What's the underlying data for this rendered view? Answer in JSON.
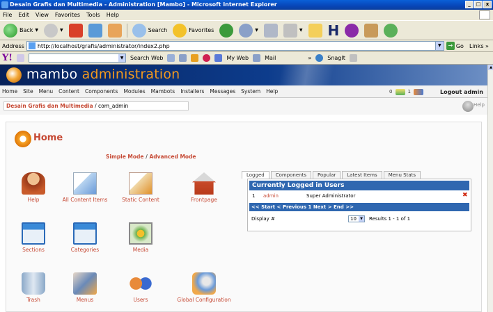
{
  "window": {
    "title": "Desain Grafis dan Multimedia - Administration [Mambo] - Microsoft Internet Explorer",
    "buttons": [
      "_",
      "□",
      "x"
    ]
  },
  "menubar": [
    "File",
    "Edit",
    "View",
    "Favorites",
    "Tools",
    "Help"
  ],
  "toolbar": {
    "back_label": "Back",
    "search_label": "Search",
    "favorites_label": "Favorites"
  },
  "addressbar": {
    "label": "Address",
    "url": "http://localhost/grafis/administrator/index2.php",
    "go_label": "Go",
    "links_label": "Links"
  },
  "yahoobar": {
    "logo": "Y!",
    "search_web_label": "Search Web",
    "my_web_label": "My Web",
    "mail_label": "Mail",
    "snagit_label": "SnagIt"
  },
  "mambo": {
    "title_main": "mambo",
    "title_accent": "administration",
    "nav": [
      "Home",
      "Site",
      "Menu",
      "Content",
      "Components",
      "Modules",
      "Mambots",
      "Installers",
      "Messages",
      "System",
      "Help"
    ],
    "messages_count": "0",
    "users_count": "1",
    "logout_label": "Logout admin",
    "pathway_site": "Desain Grafis dan Multimedia",
    "pathway_rest": " / com_admin",
    "help_label": "Help",
    "home_title": "Home",
    "simple_mode": "Simple Mode",
    "mode_sep": " / ",
    "advanced_mode": "Advanced Mode",
    "icons": [
      {
        "label": "Help"
      },
      {
        "label": "All Content Items"
      },
      {
        "label": "Static Content"
      },
      {
        "label": "Frontpage"
      },
      {
        "label": "Sections"
      },
      {
        "label": "Categories"
      },
      {
        "label": "Media"
      },
      {
        "label": "Trash"
      },
      {
        "label": "Menus"
      },
      {
        "label": "Users"
      },
      {
        "label": "Global Configuration"
      }
    ],
    "tabs": [
      "Logged",
      "Components",
      "Popular",
      "Latest Items",
      "Menu Stats"
    ],
    "logged_header": "Currently Logged in Users",
    "logged_rows": [
      {
        "num": "1",
        "user": "admin",
        "group": "Super Administrator"
      }
    ],
    "pager": "<< Start < Previous 1 Next > End >>",
    "display_label": "Display #",
    "display_value": "10",
    "results": "Results 1 - 1 of 1"
  },
  "colors": {
    "accent": "#c64934",
    "header_blue": "#2f67b0",
    "mambo_orange": "#f39a1e"
  }
}
